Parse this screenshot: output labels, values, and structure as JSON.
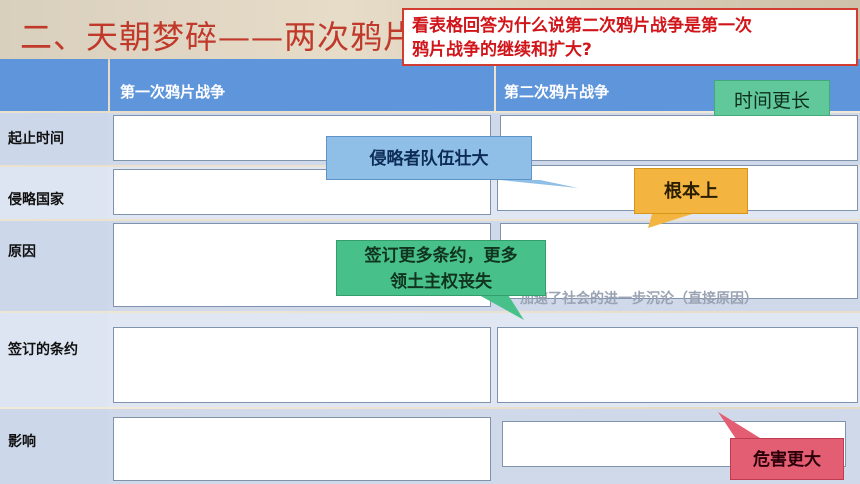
{
  "title": "二、天朝梦碎——两次鸦片",
  "question": {
    "line1": "看表格回答为什么说第二次鸦片战争是第一次",
    "line2": "鸦片战争的继续和扩大?"
  },
  "table": {
    "headers": [
      "第一次鸦片战争",
      "第二次鸦片战争"
    ],
    "rows": [
      "起止时间",
      "侵略国家",
      "原因",
      "签订的条约",
      "影响"
    ],
    "faint_text": "加速了社会的进一步沉沦（直接原因）"
  },
  "callouts": {
    "time_longer": "时间更长",
    "invaders_bigger": "侵略者队伍壮大",
    "fundamentally": "根本上",
    "more_treaties_1": "签订更多条约，更多",
    "more_treaties_2": "领土主权丧失",
    "greater_harm": "危害更大"
  },
  "colors": {
    "title": "#c0392b",
    "question_border": "#d23b2f",
    "header_blue": "#5f95db"
  }
}
